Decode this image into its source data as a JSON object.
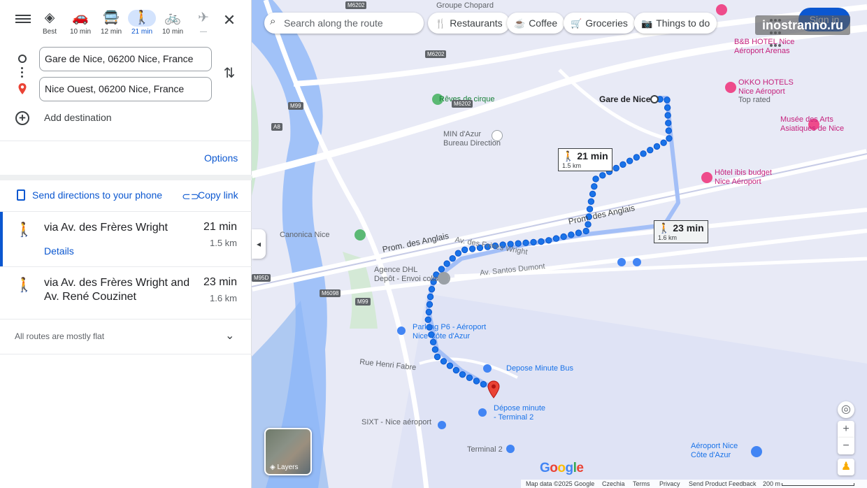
{
  "modes": [
    {
      "label": "Best",
      "icon": "diamond-route-icon",
      "glyph": "◈"
    },
    {
      "label": "10 min",
      "icon": "car-icon",
      "glyph": "🚗"
    },
    {
      "label": "12 min",
      "icon": "transit-icon",
      "glyph": "🚍"
    },
    {
      "label": "21 min",
      "icon": "walk-icon",
      "glyph": "🚶"
    },
    {
      "label": "10 min",
      "icon": "bike-icon",
      "glyph": "🚲"
    },
    {
      "label": "—",
      "icon": "flight-icon",
      "glyph": "✈"
    }
  ],
  "active_mode": "walk",
  "origin": {
    "value": "Gare de Nice, 06200 Nice, France"
  },
  "destination": {
    "value": "Nice Ouest, 06200 Nice, France"
  },
  "add_destination": "Add destination",
  "options": "Options",
  "send_directions": "Send directions to your phone",
  "copy_link": "Copy link",
  "routes": [
    {
      "via": "via Av. des Frères Wright",
      "time": "21 min",
      "distance": "1.5 km",
      "details": "Details"
    },
    {
      "via": "via Av. des Frères Wright and Av. René Couzinet",
      "time": "23 min",
      "distance": "1.6 km"
    }
  ],
  "flat_note": "All routes are mostly flat",
  "map": {
    "search_placeholder": "Search along the route",
    "chips": [
      {
        "label": "Restaurants",
        "icon": "fork-knife-icon",
        "glyph": "🍴"
      },
      {
        "label": "Coffee",
        "icon": "coffee-icon",
        "glyph": "☕"
      },
      {
        "label": "Groceries",
        "icon": "cart-icon",
        "glyph": "🛒"
      },
      {
        "label": "Things to do",
        "icon": "camera-icon",
        "glyph": "📷"
      }
    ],
    "sign_in": "Sign in",
    "watermark": "inostranno.ru",
    "place_labels": {
      "gare": "Gare de Nice",
      "reves": "Rêves de cirque",
      "min_azur": "MIN d'Azur\nBureau Direction",
      "canonica": "Canonica Nice",
      "dhl": "Agence DHL\nDepôt - Envoi colis",
      "parking": "Parking P6 - Aéroport\nNice Côte d'Azur",
      "depose_bus": "Depose Minute Bus",
      "depose_t2": "Dépose minute\n- Terminal 2",
      "sixt": "SIXT - Nice aéroport",
      "terminal2": "Terminal 2",
      "aeroport": "Aéroport Nice\nCôte d'Azur",
      "okko": "OKKO HOTELS\nNice Aéroport",
      "okko_sub": "Top rated",
      "bb": "B&B HOTEL Nice\nAéroport Arenas",
      "musee": "Musée des Arts\nAsiatiques de Nice",
      "ibis": "Hôtel ibis budget\nNice Aéroport",
      "groupe": "Groupe Chopard",
      "henri": "Rue Henri Fabre"
    },
    "road_labels": {
      "anglais1": "Prom. des Anglais",
      "anglais2": "Prom. des Anglais",
      "wright": "Av. des Frères Wright",
      "santos": "Av. Santos Dumont"
    },
    "shields": [
      "M6202",
      "M99",
      "A8",
      "M6202",
      "M95D",
      "M6098",
      "M99",
      "M6202"
    ],
    "callouts": [
      {
        "time": "21 min",
        "distance": "1.5 km"
      },
      {
        "time": "23 min",
        "distance": "1.6 km"
      }
    ],
    "layers": "Layers",
    "footer": {
      "data": "Map data ©2025 Google",
      "country": "Czechia",
      "terms": "Terms",
      "privacy": "Privacy",
      "feedback": "Send Product Feedback",
      "scale": "200 m"
    }
  }
}
